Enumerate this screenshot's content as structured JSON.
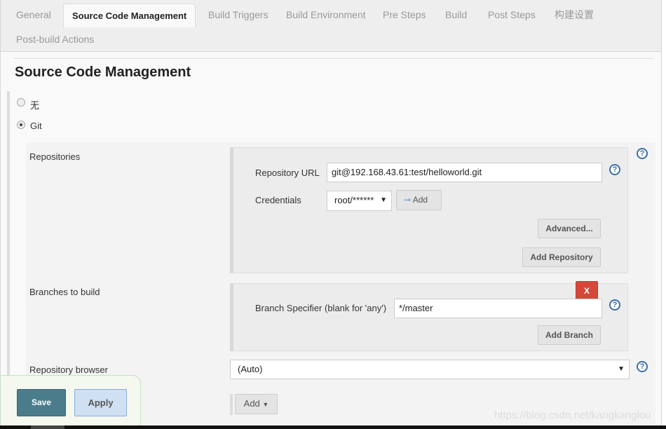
{
  "tabs": [
    {
      "label": "General"
    },
    {
      "label": "Source Code Management",
      "active": true
    },
    {
      "label": "Build Triggers"
    },
    {
      "label": "Build Environment"
    },
    {
      "label": "Pre Steps"
    },
    {
      "label": "Build"
    },
    {
      "label": "Post Steps"
    },
    {
      "label": "构建设置"
    },
    {
      "label": "Post-build Actions"
    }
  ],
  "section_title": "Source Code Management",
  "scm_options": [
    {
      "label": "无",
      "selected": false
    },
    {
      "label": "Git",
      "selected": true
    }
  ],
  "repositories": {
    "label": "Repositories",
    "url_label": "Repository URL",
    "url_value": "git@192.168.43.61:test/helloworld.git",
    "credentials_label": "Credentials",
    "credentials_value": "root/******",
    "add_label": "Add",
    "advanced_label": "Advanced...",
    "add_repository_label": "Add Repository"
  },
  "branches": {
    "label": "Branches to build",
    "delete_label": "X",
    "specifier_label": "Branch Specifier (blank for 'any')",
    "specifier_value": "*/master",
    "add_branch_label": "Add Branch"
  },
  "browser": {
    "label": "Repository browser",
    "value": "(Auto)"
  },
  "additional": {
    "add_label": "Add"
  },
  "footer": {
    "save_label": "Save",
    "apply_label": "Apply"
  },
  "watermark": "https://blog.csdn.net/kangkanglou",
  "colors": {
    "save": "#4a7c8c",
    "apply": "#cfe0f2",
    "delete": "#d24939",
    "help": "#3c6fa8"
  }
}
